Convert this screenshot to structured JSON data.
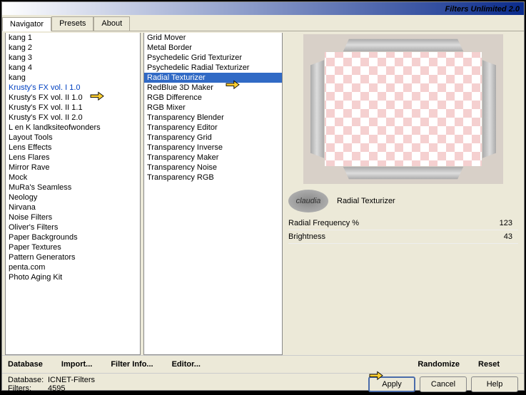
{
  "title": "Filters Unlimited 2.0",
  "tabs": [
    "Navigator",
    "Presets",
    "About"
  ],
  "active_tab": 0,
  "categories": [
    "kang 1",
    "kang 2",
    "kang 3",
    "kang 4",
    "kang",
    "Krusty's FX vol. I 1.0",
    "Krusty's FX vol. II 1.0",
    "Krusty's FX vol. II 1.1",
    "Krusty's FX vol. II 2.0",
    "L en K landksiteofwonders",
    "Layout Tools",
    "Lens Effects",
    "Lens Flares",
    "Mirror Rave",
    "Mock",
    "MuRa's Seamless",
    "Neology",
    "Nirvana",
    "Noise Filters",
    "Oliver's Filters",
    "Paper Backgrounds",
    "Paper Textures",
    "Pattern Generators",
    "penta.com",
    "Photo Aging Kit"
  ],
  "selected_category_index": 5,
  "filters": [
    "Grid Mover",
    "Metal Border",
    "Psychedelic Grid Texturizer",
    "Psychedelic Radial Texturizer",
    "Radial Texturizer",
    "RedBlue 3D Maker",
    "RGB Difference",
    "RGB Mixer",
    "Transparency Blender",
    "Transparency Editor",
    "Transparency Grid",
    "Transparency Inverse",
    "Transparency Maker",
    "Transparency Noise",
    "Transparency RGB"
  ],
  "selected_filter_index": 4,
  "logo_text": "claudia",
  "current_filter": "Radial Texturizer",
  "params": [
    {
      "label": "Radial Frequency %",
      "value": "123"
    },
    {
      "label": "Brightness",
      "value": "43"
    }
  ],
  "buttons_left": [
    "Database",
    "Import...",
    "Filter Info...",
    "Editor..."
  ],
  "buttons_right": [
    "Randomize",
    "Reset"
  ],
  "action_buttons": {
    "apply": "Apply",
    "cancel": "Cancel",
    "help": "Help"
  },
  "status": {
    "db_label": "Database:",
    "db_value": "ICNET-Filters",
    "filters_label": "Filters:",
    "filters_value": "4595"
  }
}
